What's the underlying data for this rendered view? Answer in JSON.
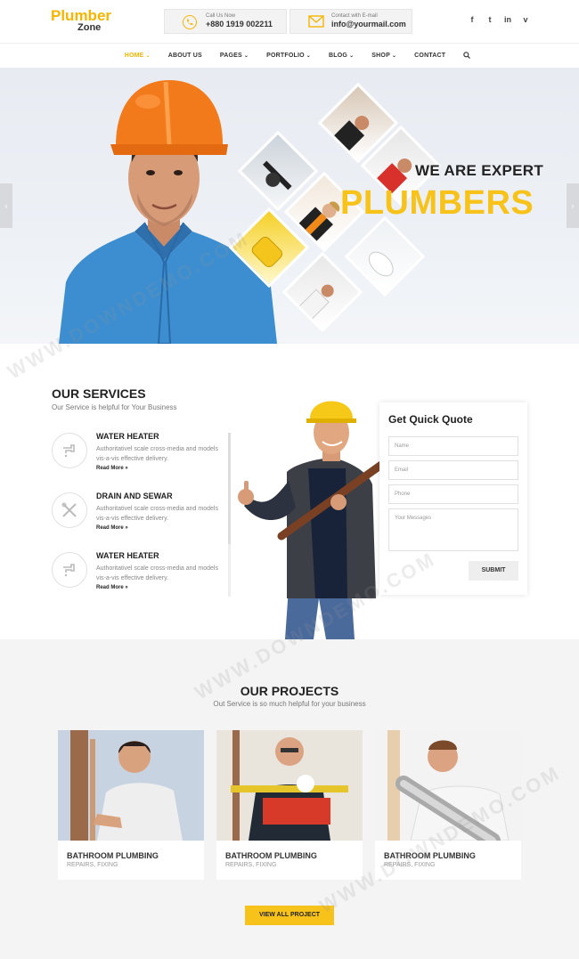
{
  "brand": {
    "line1": "Plumber",
    "line2": "Zone"
  },
  "contact": {
    "call_label": "Call Us Now",
    "call_value": "+880 1919 002211",
    "email_label": "Contact with E-mail",
    "email_value": "info@yourmail.com"
  },
  "social": [
    "f",
    "t",
    "in",
    "v"
  ],
  "nav": [
    {
      "label": "HOME",
      "caret": "⌄"
    },
    {
      "label": "ABOUT US",
      "caret": ""
    },
    {
      "label": "PAGES",
      "caret": "⌄"
    },
    {
      "label": "PORTFOLIO",
      "caret": "⌄"
    },
    {
      "label": "BLOG",
      "caret": "⌄"
    },
    {
      "label": "SHOP",
      "caret": "⌄"
    },
    {
      "label": "CONTACT",
      "caret": ""
    }
  ],
  "hero": {
    "line1": "WE ARE EXPERT",
    "line2": "PLUMBERS"
  },
  "services": {
    "title": "OUR SERVICES",
    "subtitle": "Our Service is helpful for Your Business",
    "items": [
      {
        "title": "WATER HEATER",
        "desc": "Authoritativel scale cross-media and models vis-a-vis effective delivery.",
        "link": "Read More »"
      },
      {
        "title": "DRAIN AND SEWAR",
        "desc": "Authoritativel scale cross-media and models vis-a-vis effective delivery.",
        "link": "Read More »"
      },
      {
        "title": "WATER HEATER",
        "desc": "Authoritativel scale cross-media and models vis-a-vis effective delivery.",
        "link": "Read More »"
      }
    ]
  },
  "quote": {
    "title": "Get Quick Quote",
    "name_ph": "Name",
    "email_ph": "Email",
    "phone_ph": "Phone",
    "msg_ph": "Your Messages",
    "submit": "SUBMIT"
  },
  "projects": {
    "title": "OUR PROJECTS",
    "subtitle": "Out Service is so much helpful for your business",
    "cards": [
      {
        "title": "BATHROOM PLUMBING",
        "tags": "REPAIRS, FIXING"
      },
      {
        "title": "BATHROOM PLUMBING",
        "tags": "REPAIRS, FIXING"
      },
      {
        "title": "BATHROOM PLUMBING",
        "tags": "REPAIRS, FIXING"
      }
    ],
    "button": "VIEW ALL PROJECT"
  },
  "watermark": "WWW.DOWNDEMO.COM",
  "colors": {
    "accent": "#f7c21a",
    "logo": "#f7b500"
  },
  "icons": [
    "phone-icon",
    "mail-icon",
    "search-icon",
    "faucet-icon",
    "tools-icon"
  ]
}
